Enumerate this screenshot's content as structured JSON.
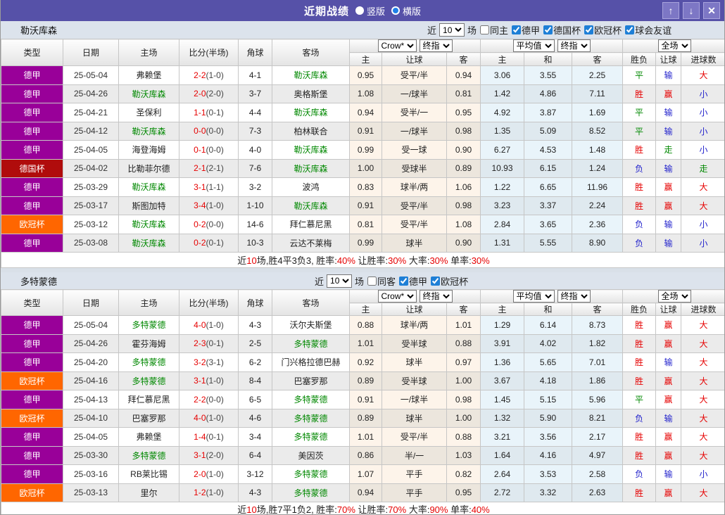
{
  "window": {
    "title": "近期战绩",
    "view_options": [
      {
        "label": "竖版",
        "selected": false
      },
      {
        "label": "横版",
        "selected": true
      }
    ],
    "buttons": [
      {
        "name": "move-up-button",
        "glyph": "↑"
      },
      {
        "name": "move-down-button",
        "glyph": "↓"
      },
      {
        "name": "close-button",
        "glyph": "✕"
      }
    ]
  },
  "table_header": {
    "row1": [
      "类型",
      "日期",
      "主场",
      "比分(半场)",
      "角球",
      "客场"
    ],
    "dropdowns": {
      "source": "Crow*",
      "source_type": "终指",
      "average": "平均值",
      "average_type": "终指",
      "scope": "全场"
    },
    "row2": [
      "主",
      "让球",
      "客",
      "主",
      "和",
      "客",
      "胜负",
      "让球",
      "进球数"
    ]
  },
  "colors": {
    "leagues": {
      "德甲": "#990099",
      "德国杯": "#b00c0c",
      "欧冠杯": "#ff6600"
    },
    "results": {
      "胜": "#e60000",
      "赢": "#e60000",
      "大": "#e60000",
      "平": "#008800",
      "走": "#008800",
      "负": "#2323cc",
      "输": "#2323cc",
      "小": "#2323cc"
    },
    "accent_purple": "#5651a8",
    "focus_team_green": "#008800",
    "score_red": "#e60000"
  },
  "sections": [
    {
      "team": "勒沃库森",
      "filter": {
        "recent_label": "近",
        "matches_value": "10",
        "matches_suffix": "场",
        "same_venue_label": "同主",
        "same_venue_checked": false,
        "leagues": [
          {
            "label": "德甲",
            "checked": true
          },
          {
            "label": "德国杯",
            "checked": true
          },
          {
            "label": "欧冠杯",
            "checked": true
          },
          {
            "label": "球会友谊",
            "checked": true
          }
        ]
      },
      "rows": [
        [
          "德甲",
          "25-05-04",
          "弗赖堡",
          "2-2",
          "(1-0)",
          "4-1",
          "勒沃库森",
          "away",
          "0.95",
          "受平/半",
          "0.94",
          "3.06",
          "3.55",
          "2.25",
          "平",
          "输",
          "大"
        ],
        [
          "德甲",
          "25-04-26",
          "勒沃库森",
          "2-0",
          "(2-0)",
          "3-7",
          "奥格斯堡",
          "home",
          "1.08",
          "一/球半",
          "0.81",
          "1.42",
          "4.86",
          "7.11",
          "胜",
          "赢",
          "小"
        ],
        [
          "德甲",
          "25-04-21",
          "圣保利",
          "1-1",
          "(0-1)",
          "4-4",
          "勒沃库森",
          "away",
          "0.94",
          "受半/一",
          "0.95",
          "4.92",
          "3.87",
          "1.69",
          "平",
          "输",
          "小"
        ],
        [
          "德甲",
          "25-04-12",
          "勒沃库森",
          "0-0",
          "(0-0)",
          "7-3",
          "柏林联合",
          "home",
          "0.91",
          "一/球半",
          "0.98",
          "1.35",
          "5.09",
          "8.52",
          "平",
          "输",
          "小"
        ],
        [
          "德甲",
          "25-04-05",
          "海登海姆",
          "0-1",
          "(0-0)",
          "4-0",
          "勒沃库森",
          "away",
          "0.99",
          "受一球",
          "0.90",
          "6.27",
          "4.53",
          "1.48",
          "胜",
          "走",
          "小"
        ],
        [
          "德国杯",
          "25-04-02",
          "比勒菲尔德",
          "2-1",
          "(2-1)",
          "7-6",
          "勒沃库森",
          "away",
          "1.00",
          "受球半",
          "0.89",
          "10.93",
          "6.15",
          "1.24",
          "负",
          "输",
          "走"
        ],
        [
          "德甲",
          "25-03-29",
          "勒沃库森",
          "3-1",
          "(1-1)",
          "3-2",
          "波鸿",
          "home",
          "0.83",
          "球半/两",
          "1.06",
          "1.22",
          "6.65",
          "11.96",
          "胜",
          "赢",
          "大"
        ],
        [
          "德甲",
          "25-03-17",
          "斯图加特",
          "3-4",
          "(1-0)",
          "1-10",
          "勒沃库森",
          "away",
          "0.91",
          "受平/半",
          "0.98",
          "3.23",
          "3.37",
          "2.24",
          "胜",
          "赢",
          "大"
        ],
        [
          "欧冠杯",
          "25-03-12",
          "勒沃库森",
          "0-2",
          "(0-0)",
          "14-6",
          "拜仁慕尼黑",
          "home",
          "0.81",
          "受平/半",
          "1.08",
          "2.84",
          "3.65",
          "2.36",
          "负",
          "输",
          "小"
        ],
        [
          "德甲",
          "25-03-08",
          "勒沃库森",
          "0-2",
          "(0-1)",
          "10-3",
          "云达不莱梅",
          "home",
          "0.99",
          "球半",
          "0.90",
          "1.31",
          "5.55",
          "8.90",
          "负",
          "输",
          "小"
        ]
      ],
      "summary": [
        {
          "t": "近",
          "red": false
        },
        {
          "t": "10",
          "red": true
        },
        {
          "t": "场,胜4平3负3, 胜率:",
          "red": false
        },
        {
          "t": "40%",
          "red": true
        },
        {
          "t": " 让胜率:",
          "red": false
        },
        {
          "t": "30%",
          "red": true
        },
        {
          "t": " 大率:",
          "red": false
        },
        {
          "t": "30%",
          "red": true
        },
        {
          "t": " 单率:",
          "red": false
        },
        {
          "t": "30%",
          "red": true
        }
      ]
    },
    {
      "team": "多特蒙德",
      "filter": {
        "recent_label": "近",
        "matches_value": "10",
        "matches_suffix": "场",
        "same_venue_label": "同客",
        "same_venue_checked": false,
        "leagues": [
          {
            "label": "德甲",
            "checked": true
          },
          {
            "label": "欧冠杯",
            "checked": true
          }
        ]
      },
      "rows": [
        [
          "德甲",
          "25-05-04",
          "多特蒙德",
          "4-0",
          "(1-0)",
          "4-3",
          "沃尔夫斯堡",
          "home",
          "0.88",
          "球半/两",
          "1.01",
          "1.29",
          "6.14",
          "8.73",
          "胜",
          "赢",
          "大"
        ],
        [
          "德甲",
          "25-04-26",
          "霍芬海姆",
          "2-3",
          "(0-1)",
          "2-5",
          "多特蒙德",
          "away",
          "1.01",
          "受半球",
          "0.88",
          "3.91",
          "4.02",
          "1.82",
          "胜",
          "赢",
          "大"
        ],
        [
          "德甲",
          "25-04-20",
          "多特蒙德",
          "3-2",
          "(3-1)",
          "6-2",
          "门兴格拉德巴赫",
          "home",
          "0.92",
          "球半",
          "0.97",
          "1.36",
          "5.65",
          "7.01",
          "胜",
          "输",
          "大"
        ],
        [
          "欧冠杯",
          "25-04-16",
          "多特蒙德",
          "3-1",
          "(1-0)",
          "8-4",
          "巴塞罗那",
          "home",
          "0.89",
          "受半球",
          "1.00",
          "3.67",
          "4.18",
          "1.86",
          "胜",
          "赢",
          "大"
        ],
        [
          "德甲",
          "25-04-13",
          "拜仁慕尼黑",
          "2-2",
          "(0-0)",
          "6-5",
          "多特蒙德",
          "away",
          "0.91",
          "一/球半",
          "0.98",
          "1.45",
          "5.15",
          "5.96",
          "平",
          "赢",
          "大"
        ],
        [
          "欧冠杯",
          "25-04-10",
          "巴塞罗那",
          "4-0",
          "(1-0)",
          "4-6",
          "多特蒙德",
          "away",
          "0.89",
          "球半",
          "1.00",
          "1.32",
          "5.90",
          "8.21",
          "负",
          "输",
          "大"
        ],
        [
          "德甲",
          "25-04-05",
          "弗赖堡",
          "1-4",
          "(0-1)",
          "3-4",
          "多特蒙德",
          "away",
          "1.01",
          "受平/半",
          "0.88",
          "3.21",
          "3.56",
          "2.17",
          "胜",
          "赢",
          "大"
        ],
        [
          "德甲",
          "25-03-30",
          "多特蒙德",
          "3-1",
          "(2-0)",
          "6-4",
          "美因茨",
          "home",
          "0.86",
          "半/一",
          "1.03",
          "1.64",
          "4.16",
          "4.97",
          "胜",
          "赢",
          "大"
        ],
        [
          "德甲",
          "25-03-16",
          "RB莱比锡",
          "2-0",
          "(1-0)",
          "3-12",
          "多特蒙德",
          "away",
          "1.07",
          "平手",
          "0.82",
          "2.64",
          "3.53",
          "2.58",
          "负",
          "输",
          "小"
        ],
        [
          "欧冠杯",
          "25-03-13",
          "里尔",
          "1-2",
          "(1-0)",
          "4-3",
          "多特蒙德",
          "away",
          "0.94",
          "平手",
          "0.95",
          "2.72",
          "3.32",
          "2.63",
          "胜",
          "赢",
          "大"
        ]
      ],
      "summary": [
        {
          "t": "近",
          "red": false
        },
        {
          "t": "10",
          "red": true
        },
        {
          "t": "场,胜7平1负2, 胜率:",
          "red": false
        },
        {
          "t": "70%",
          "red": true
        },
        {
          "t": " 让胜率:",
          "red": false
        },
        {
          "t": "70%",
          "red": true
        },
        {
          "t": " 大率:",
          "red": false
        },
        {
          "t": "90%",
          "red": true
        },
        {
          "t": " 单率:",
          "red": false
        },
        {
          "t": "40%",
          "red": true
        }
      ]
    }
  ]
}
